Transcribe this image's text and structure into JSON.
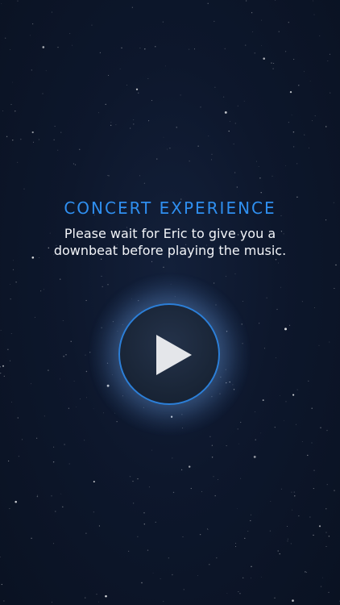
{
  "screen": {
    "heading": "CONCERT EXPERIENCE",
    "message": "Please wait for Eric to give you a downbeat before playing the music.",
    "play_button": {
      "icon": "play-icon"
    }
  },
  "colors": {
    "background": "#0b1426",
    "heading": "#2f8ff0",
    "message": "#f2f4f8",
    "button_ring": "#2c7fd8",
    "play_icon": "#e4e6ea"
  }
}
